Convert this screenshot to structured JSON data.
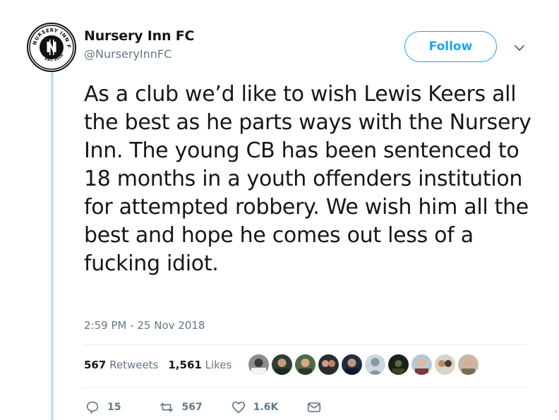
{
  "account": {
    "name": "Nursery Inn FC",
    "handle": "@NurseryInnFC",
    "logo_text": "NURSERY INN FC",
    "logo_est": "EST. 2016"
  },
  "follow_label": "Follow",
  "tweet": {
    "text": "As a club we’d like to wish Lewis Keers all the best as he parts ways with the Nursery Inn. The young CB has been sentenced to 18 months in a youth offenders institution for attempted robbery. We wish him all the best and hope he comes out less of a fucking idiot.",
    "timestamp": "2:59 PM - 25 Nov 2018"
  },
  "stats": {
    "retweets_count": "567",
    "retweets_label": "Retweets",
    "likes_count": "1,561",
    "likes_label": "Likes"
  },
  "actions": {
    "replies": "15",
    "retweets": "567",
    "likes": "1.6K"
  },
  "colors": {
    "accent": "#1da1f2",
    "thread": "#c2e2f7",
    "muted": "#657786"
  }
}
